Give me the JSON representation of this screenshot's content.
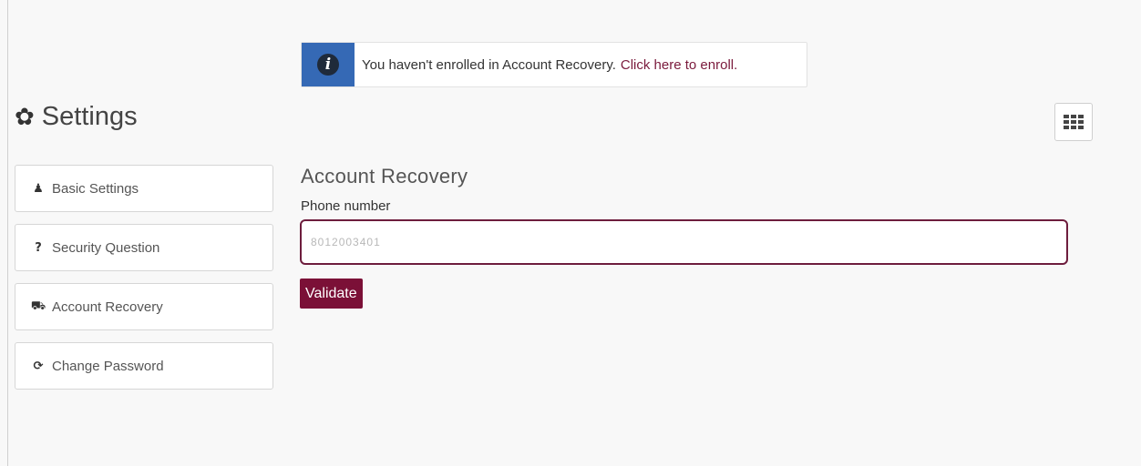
{
  "banner": {
    "icon": "info-icon",
    "message": "You haven't enrolled in Account Recovery.",
    "link_label": "Click here to enroll.",
    "icon_bg_color": "#3569b5",
    "link_color": "#7a1a3c"
  },
  "header": {
    "icon": "gear-icon",
    "title": "Settings"
  },
  "toolbar": {
    "apps_icon": "grid-icon"
  },
  "sidebar": {
    "items": [
      {
        "label": "Basic Settings",
        "icon": "user-icon",
        "glyph": "♟"
      },
      {
        "label": "Security Question",
        "icon": "question-icon",
        "glyph": "?"
      },
      {
        "label": "Account Recovery",
        "icon": "ambulance-icon",
        "glyph": "⛟"
      },
      {
        "label": "Change Password",
        "icon": "refresh-icon",
        "glyph": "⟳"
      }
    ]
  },
  "main": {
    "section_title": "Account Recovery",
    "phone_label": "Phone number",
    "phone_value": "8012003401",
    "validate_label": "Validate",
    "accent_color": "#7b1037"
  }
}
